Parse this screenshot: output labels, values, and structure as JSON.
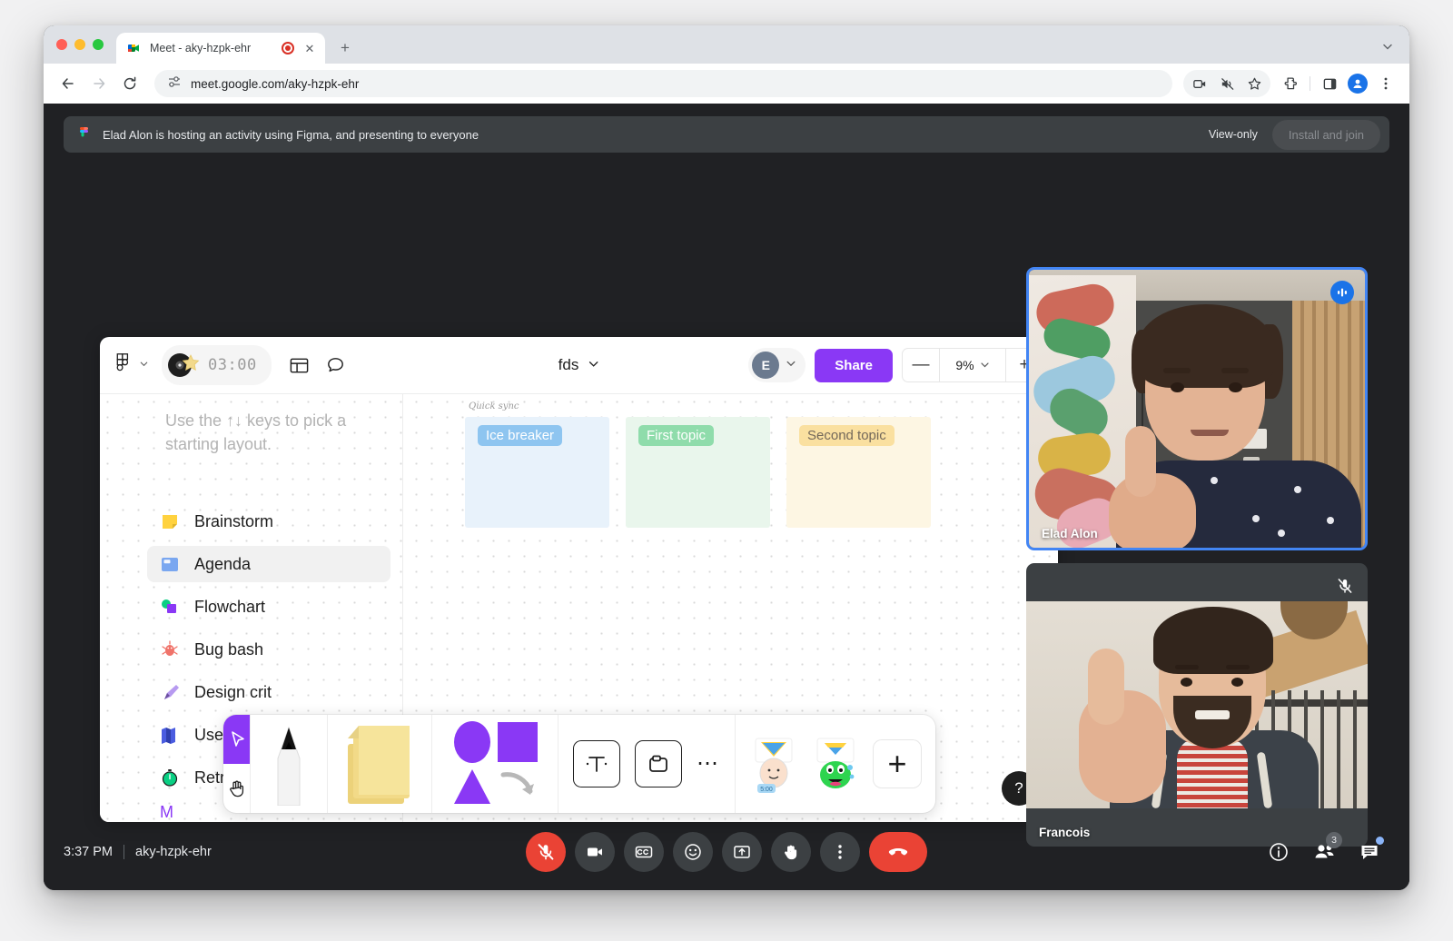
{
  "browser": {
    "tab": {
      "title": "Meet - aky-hzpk-ehr",
      "favicon_icon": "google-meet-icon",
      "recording_icon": "recording-indicator-icon",
      "close_icon": "close-icon"
    },
    "new_tab_icon": "new-tab-plus-icon",
    "tabstrip_chevron_icon": "chevron-down-icon",
    "back_icon": "back-arrow-icon",
    "forward_icon": "forward-arrow-icon",
    "reload_icon": "reload-icon",
    "site_settings_icon": "tune-sliders-icon",
    "url": "meet.google.com/aky-hzpk-ehr",
    "toolbar_icons": [
      "screen-share-icon",
      "audio-muted-tab-icon",
      "bookmark-star-icon",
      "extensions-puzzle-icon",
      "side-panel-icon",
      "profile-avatar-icon",
      "browser-menu-icon"
    ]
  },
  "meet": {
    "banner": {
      "app_icon": "figma-icon",
      "message": "Elad Alon is hosting an activity using Figma, and presenting to everyone",
      "view_only_label": "View-only",
      "install_button_label": "Install and join"
    },
    "tiles": [
      {
        "name": "Elad Alon",
        "badge_icon": "audio-level-icon",
        "active_speaker": true
      },
      {
        "name": "Francois",
        "badge_icon": "mic-off-icon",
        "active_speaker": false
      }
    ],
    "bottom_bar": {
      "time": "3:37 PM",
      "separator": "|",
      "meeting_code": "aky-hzpk-ehr",
      "controls": [
        {
          "name": "microphone-muted-button",
          "icon": "mic-off-icon",
          "style": "red"
        },
        {
          "name": "camera-button",
          "icon": "video-camera-icon",
          "style": "grey"
        },
        {
          "name": "captions-button",
          "icon": "closed-captions-icon",
          "style": "grey"
        },
        {
          "name": "reactions-button",
          "icon": "emoji-smile-icon",
          "style": "grey"
        },
        {
          "name": "present-screen-button",
          "icon": "present-screen-icon",
          "style": "grey"
        },
        {
          "name": "raise-hand-button",
          "icon": "raise-hand-icon",
          "style": "grey"
        },
        {
          "name": "more-options-button",
          "icon": "more-vertical-icon",
          "style": "grey"
        },
        {
          "name": "end-call-button",
          "icon": "hangup-phone-icon",
          "style": "hangup"
        }
      ],
      "right_icons": [
        {
          "name": "meeting-details-button",
          "icon": "info-circle-icon",
          "badge": ""
        },
        {
          "name": "participants-button",
          "icon": "people-icon",
          "badge": "3"
        },
        {
          "name": "chat-button",
          "icon": "chat-bubble-icon",
          "badge": "dot"
        }
      ]
    }
  },
  "figma": {
    "toolbar": {
      "logo_icon": "figma-logo-icon",
      "logo_chevron_icon": "chevron-down-icon",
      "timer_value": "03:00",
      "timer_art_icon": "music-disc-star-icon",
      "layout_icon": "layout-panels-icon",
      "comment_icon": "comment-bubble-icon",
      "file_name": "fds",
      "file_chevron_icon": "chevron-down-icon",
      "avatar_initial": "E",
      "avatar_chevron_icon": "chevron-down-icon",
      "share_label": "Share",
      "zoom_minus": "—",
      "zoom_value": "9%",
      "zoom_chevron_icon": "chevron-down-icon",
      "zoom_plus": "+"
    },
    "panel": {
      "hint": "Use the ↑↓ keys to pick a starting layout.",
      "items": [
        {
          "label": "Brainstorm",
          "icon": "sticky-note-icon",
          "selected": false
        },
        {
          "label": "Agenda",
          "icon": "agenda-board-icon",
          "selected": true
        },
        {
          "label": "Flowchart",
          "icon": "flowchart-shapes-icon",
          "selected": false
        },
        {
          "label": "Bug bash",
          "icon": "bug-icon",
          "selected": false
        },
        {
          "label": "Design crit",
          "icon": "pen-nib-icon",
          "selected": false
        },
        {
          "label": "User journey",
          "icon": "map-icon",
          "selected": false
        },
        {
          "label": "Retro",
          "icon": "stopwatch-icon",
          "selected": false
        }
      ],
      "more_label": "M"
    },
    "board": {
      "title": "Quick sync",
      "columns": [
        {
          "label": "Ice breaker"
        },
        {
          "label": "First topic"
        },
        {
          "label": "Second topic"
        }
      ]
    },
    "bottom_toolbar": {
      "cursor_icon": "cursor-arrow-icon",
      "hand_icon": "hand-pan-icon",
      "pen_icon": "pen-marker-icon",
      "sticky_icon": "sticky-notes-stack-icon",
      "shapes_icon": "shapes-icon",
      "text_icon": "text-tool-icon",
      "frame_icon": "frame-tool-icon",
      "more_icon": "more-horizontal-icon",
      "sticker_1_icon": "sticker-face-icon",
      "sticker_2_icon": "sticker-monster-icon",
      "add_widget_label": "+"
    },
    "help_label": "?"
  }
}
